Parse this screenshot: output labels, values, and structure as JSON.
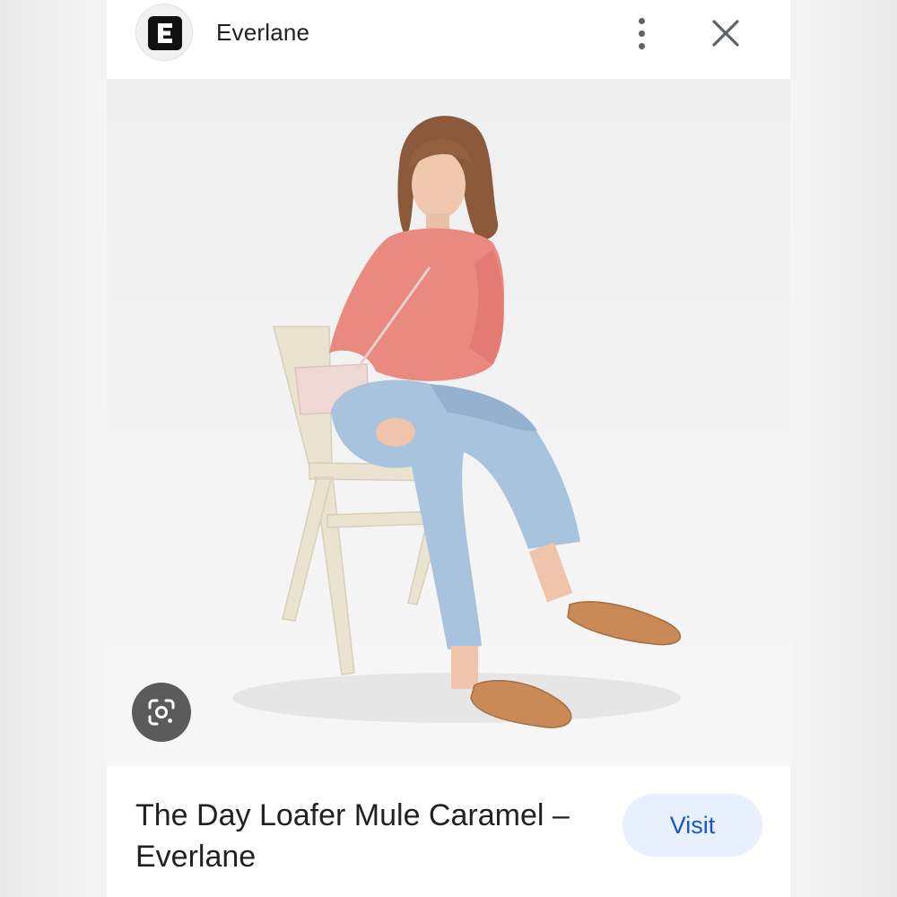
{
  "header": {
    "site_name": "Everlane",
    "logo_letter": "E",
    "more_icon": "more-vert-icon",
    "close_icon": "close-icon"
  },
  "image": {
    "lens_icon": "google-lens-icon"
  },
  "footer": {
    "title": "The Day Loafer Mule Caramel – Everlane",
    "visit_label": "Visit"
  },
  "colors": {
    "visit_bg": "#e8f0fe",
    "visit_text": "#1a56c8",
    "lens_bg": "#5b5b5b"
  }
}
